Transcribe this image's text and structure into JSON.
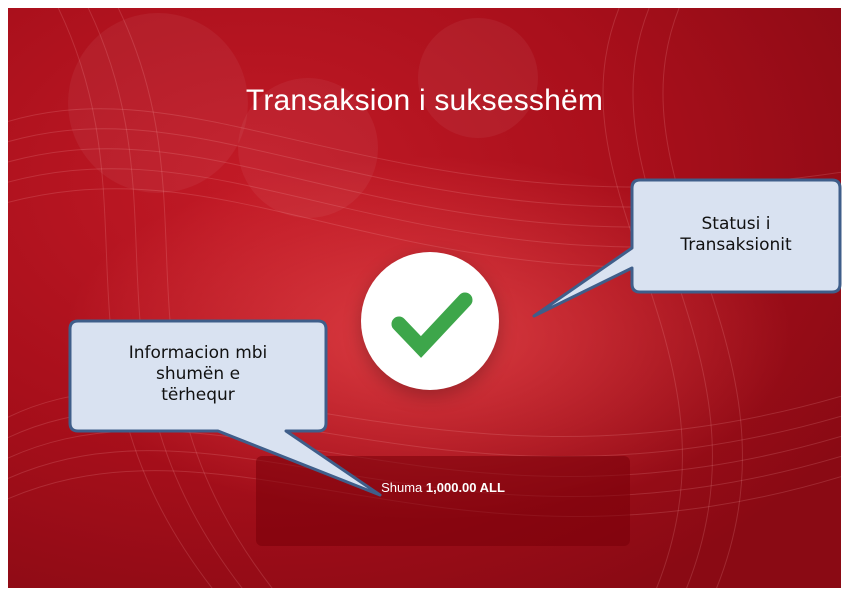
{
  "screen": {
    "title": "Transaksion i suksesshëm",
    "status_icon": "check-mark-icon",
    "amount": {
      "label": "Shuma",
      "value": "1,000.00 ALL"
    }
  },
  "callouts": {
    "status": {
      "lines": [
        "Statusi i",
        "Transaksionit"
      ]
    },
    "amount_info": {
      "lines": [
        "Informacion mbi",
        "shumën e",
        "tërhequr"
      ]
    }
  },
  "colors": {
    "background_red": "#b5131f",
    "check_green": "#3da64a",
    "callout_fill": "#d9e2f1",
    "callout_border": "#3f5e8a"
  }
}
